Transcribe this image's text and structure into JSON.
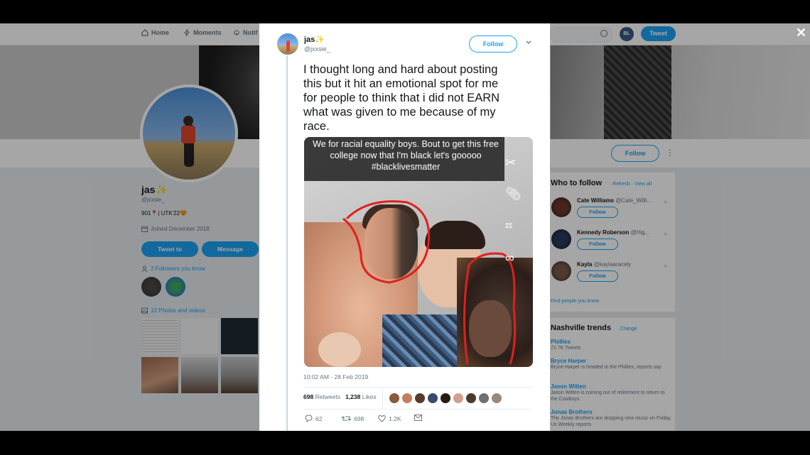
{
  "nav": {
    "home": "Home",
    "moments": "Moments",
    "notifications": "Notif",
    "avatar_text": "BL",
    "tweet_button": "Tweet"
  },
  "profile": {
    "name": "jas",
    "name_emoji": "✨",
    "handle": "@jxxsie_",
    "bio": "901📍| UTK'22🧡",
    "joined": "Joined December 2018",
    "tweet_to": "Tweet to",
    "message": "Message",
    "followers_you_know": "2 Followers you know",
    "photos_videos": "12 Photos and videos",
    "follow": "Follow"
  },
  "who_to_follow": {
    "title": "Who to follow",
    "links": "· Refresh · View all",
    "items": [
      {
        "name": "Cate Williams",
        "handle": "@Cate_Willi...",
        "follow": "Follow"
      },
      {
        "name": "Kennedy Roberson",
        "handle": "@Hig...",
        "follow": "Follow"
      },
      {
        "name": "Kayla",
        "handle": "@kaylaaracely",
        "follow": "Follow"
      }
    ],
    "find_people": "Find people you know"
  },
  "trends": {
    "title": "Nashville trends",
    "change": "· Change",
    "items": [
      {
        "name": "Phillies",
        "desc": "72.7K Tweets"
      },
      {
        "name": "Bryce Harper",
        "desc": "Bryce Harper is headed to the Phillies, reports say"
      },
      {
        "name": "Jason Witten",
        "desc": "Jason Witten is coming out of retirement to return to the Cowboys"
      },
      {
        "name": "Jonas Brothers",
        "desc": "The Jonas Brothers are dropping new music on Friday, Us Weekly reports"
      }
    ]
  },
  "tweet": {
    "name": "jas",
    "name_emoji": "✨",
    "handle": "@jxxsie_",
    "follow": "Follow",
    "text": "I thought long and hard about posting\nthis but it hit an emotional spot for me\nfor people to think that i did not EARN\nwhat was given to me because of my\nrace.",
    "photo_caption": "We for racial equality boys. Bout to get this free\ncollege now that I'm black let's gooooo\n#blacklivesmatter",
    "timestamp": "10:02 AM - 28 Feb 2019",
    "retweets_count": "698",
    "retweets_label": "Retweets",
    "likes_count": "1,238",
    "likes_label": "Likes",
    "replies": "62",
    "retweet_action": "698",
    "like_action": "1.2K"
  },
  "colors": {
    "accent": "#1da1f2",
    "annotation_red": "#e02020"
  }
}
